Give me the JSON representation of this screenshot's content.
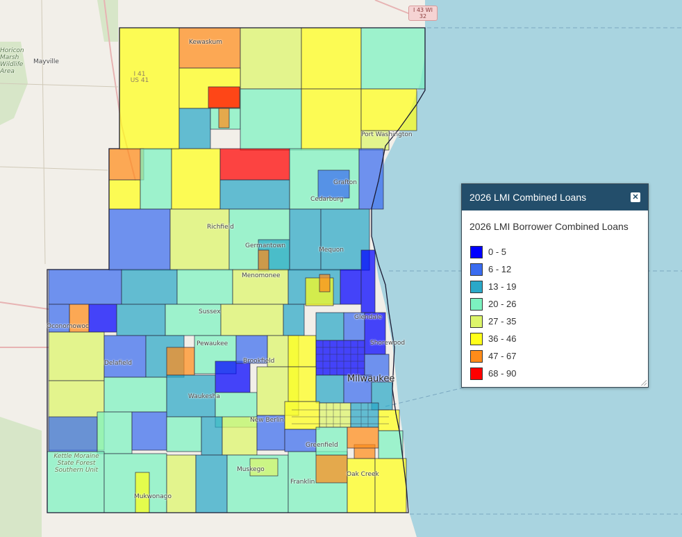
{
  "legend": {
    "title": "2026 LMI Combined Loans",
    "close_icon": "close-icon",
    "subtitle": "2026 LMI Borrower Combined Loans",
    "items": [
      {
        "label": "0 - 5",
        "color": "#0000ff"
      },
      {
        "label": "6 - 12",
        "color": "#3a6cf0"
      },
      {
        "label": "13 - 19",
        "color": "#2aa8c8"
      },
      {
        "label": "20 - 26",
        "color": "#7cf2c0"
      },
      {
        "label": "27 - 35",
        "color": "#ddf56a"
      },
      {
        "label": "36 - 46",
        "color": "#ffff1a"
      },
      {
        "label": "47 - 67",
        "color": "#ff8c1a"
      },
      {
        "label": "68 - 90",
        "color": "#ff0000"
      }
    ]
  },
  "map": {
    "water_color": "#a9d4e0",
    "land_color": "#f2efe9",
    "places": [
      "Mayville",
      "Kewaskum",
      "Port Washington",
      "Germantown",
      "Richfield",
      "Menomonee",
      "Mequon",
      "Cedarburg",
      "Grafton",
      "Milwaukee",
      "Pewaukee",
      "Brookfield",
      "Waukesha",
      "New Berlin",
      "Muskego",
      "Franklin",
      "Oak Creek",
      "Mukwonago",
      "Oconomowoc",
      "Delafield",
      "Glendale",
      "Shorewood",
      "Sussex",
      "Greenfield",
      "Kettle Moraine State Forest Southern Unit",
      "Horicon Marsh Wildlife Area"
    ],
    "road_shields": [
      "I 43 WI 32",
      "I 41 US 41"
    ]
  }
}
